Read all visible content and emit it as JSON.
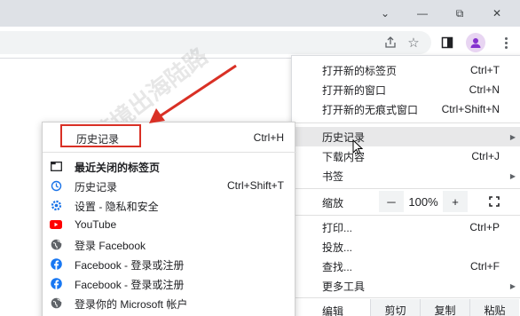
{
  "window_controls": {
    "minimize": "—",
    "maximize": "⧉",
    "close": "✕",
    "dropdown": "⌄"
  },
  "toolbar": {
    "star_icon": "☆"
  },
  "menu": {
    "items": [
      {
        "label": "打开新的标签页",
        "shortcut": "Ctrl+T"
      },
      {
        "label": "打开新的窗口",
        "shortcut": "Ctrl+N"
      },
      {
        "label": "打开新的无痕式窗口",
        "shortcut": "Ctrl+Shift+N"
      },
      {
        "label": "历史记录",
        "shortcut": ""
      },
      {
        "label": "下载内容",
        "shortcut": "Ctrl+J"
      },
      {
        "label": "书签",
        "shortcut": ""
      },
      {
        "label": "打印...",
        "shortcut": "Ctrl+P"
      },
      {
        "label": "投放...",
        "shortcut": ""
      },
      {
        "label": "查找...",
        "shortcut": "Ctrl+F"
      },
      {
        "label": "更多工具",
        "shortcut": ""
      }
    ],
    "zoom": {
      "label": "缩放",
      "minus": "－",
      "value": "100%",
      "plus": "+",
      "fullscreen": "⛶"
    },
    "edit": {
      "label": "编辑",
      "cut": "剪切",
      "copy": "复制",
      "paste": "粘贴"
    }
  },
  "submenu": {
    "header": {
      "label": "历史记录",
      "shortcut": "Ctrl+H"
    },
    "items": [
      {
        "label": "最近关闭的标签页",
        "shortcut": "",
        "icon": "tab-icon"
      },
      {
        "label": "历史记录",
        "shortcut": "Ctrl+Shift+T",
        "icon": "history-icon"
      },
      {
        "label": "设置 - 隐私和安全",
        "shortcut": "",
        "icon": "settings-icon"
      },
      {
        "label": "YouTube",
        "shortcut": "",
        "icon": "youtube-icon"
      },
      {
        "label": "登录 Facebook",
        "shortcut": "",
        "icon": "globe-icon"
      },
      {
        "label": "Facebook - 登录或注册",
        "shortcut": "",
        "icon": "facebook-icon"
      },
      {
        "label": "Facebook - 登录或注册",
        "shortcut": "",
        "icon": "facebook-icon"
      },
      {
        "label": "登录你的 Microsoft 帐户",
        "shortcut": "",
        "icon": "globe-icon"
      }
    ]
  },
  "watermark": {
    "text": "跨境出海陆路"
  },
  "colors": {
    "annotation_red": "#d93025",
    "highlight": "#e8e8e9",
    "facebook_blue": "#1877f2",
    "youtube_red": "#ff0000",
    "google_blue": "#1a73e8"
  }
}
